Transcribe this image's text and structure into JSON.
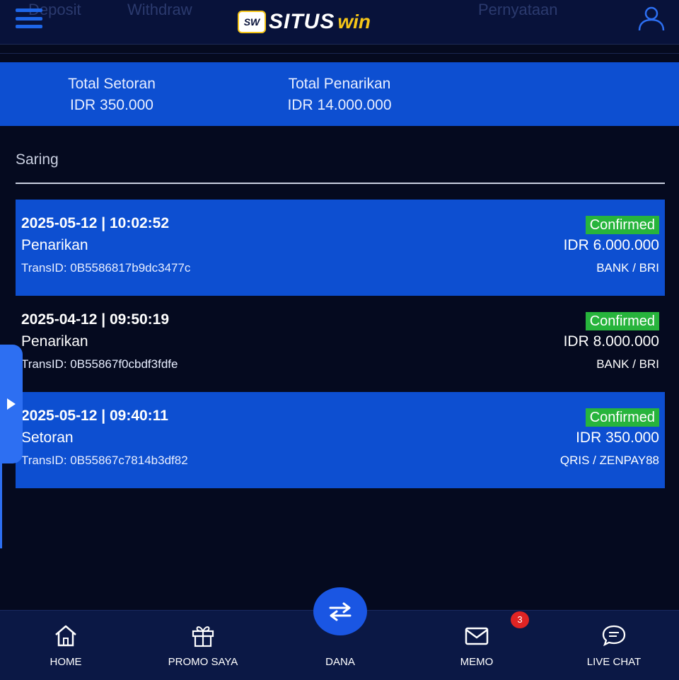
{
  "header": {
    "ghost_tabs": [
      "Deposit",
      "Withdraw",
      "Pernyataan"
    ],
    "logo": {
      "badge": "SW",
      "situs": "SITUS",
      "win": "win"
    }
  },
  "summary": {
    "deposit_label": "Total Setoran",
    "deposit_value": "IDR 350.000",
    "withdraw_label": "Total Penarikan",
    "withdraw_value": "IDR 14.000.000"
  },
  "filter": {
    "label": "Saring"
  },
  "transactions": [
    {
      "datetime": "2025-05-12 | 10:02:52",
      "type": "Penarikan",
      "trans_id": "TransID: 0B5586817b9dc3477c",
      "status": "Confirmed",
      "amount": "IDR 6.000.000",
      "method": "BANK / BRI"
    },
    {
      "datetime": "2025-04-12 | 09:50:19",
      "type": "Penarikan",
      "trans_id": "TransID: 0B55867f0cbdf3fdfe",
      "status": "Confirmed",
      "amount": "IDR 8.000.000",
      "method": "BANK / BRI"
    },
    {
      "datetime": "2025-05-12 | 09:40:11",
      "type": "Setoran",
      "trans_id": "TransID: 0B55867c7814b3df82",
      "status": "Confirmed",
      "amount": "IDR 350.000",
      "method": "QRIS / ZENPAY88"
    }
  ],
  "bottom_nav": {
    "items": [
      {
        "label": "HOME",
        "icon": "home-icon"
      },
      {
        "label": "PROMO SAYA",
        "icon": "gift-icon"
      },
      {
        "label": "DANA",
        "icon": "transfer-icon"
      },
      {
        "label": "MEMO",
        "icon": "mail-icon",
        "badge": "3"
      },
      {
        "label": "LIVE CHAT",
        "icon": "chat-icon"
      }
    ]
  },
  "colors": {
    "background": "#050a1f",
    "header": "#08123a",
    "accent_blue": "#0d4fd1",
    "status_green": "#27b43c",
    "logo_yellow": "#f5c518",
    "badge_red": "#e02424"
  }
}
